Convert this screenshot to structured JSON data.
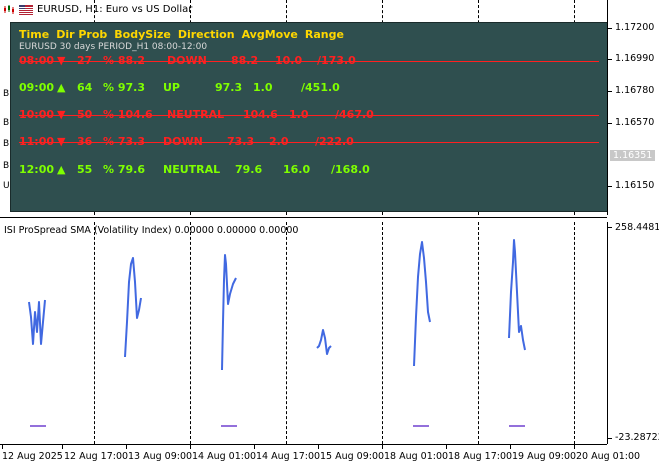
{
  "chart": {
    "symbol_title": "EURUSD, H1:  Euro vs US Dollar",
    "left_peek_labels": [
      "B",
      "B",
      "B",
      "B",
      "U"
    ],
    "price_ticks": [
      "1.17200",
      "1.16990",
      "1.16780",
      "1.16570",
      "1.16150"
    ],
    "current_price": "1.16351"
  },
  "panel": {
    "headers": [
      "Time",
      "Dir Prob",
      "BodySize",
      "Direction",
      "AvgMove",
      "Range"
    ],
    "subtitle": "EURUSD 30 days PERIOD_H1 08:00-12:00",
    "rows": [
      {
        "time": "08:00",
        "arrow": "▼",
        "prob": "27",
        "body": "% 88.2",
        "direction": "DOWN",
        "avg": "88.2",
        "x": "10.0",
        "range": "/173.0",
        "color": "red"
      },
      {
        "time": "09:00",
        "arrow": "▲",
        "prob": "64",
        "body": "% 97.3",
        "direction": "UP",
        "avg": "97.3",
        "x": "1.0",
        "range": "/451.0",
        "color": "green"
      },
      {
        "time": "10:00",
        "arrow": "▼",
        "prob": "50",
        "body": "% 104.6",
        "direction": "NEUTRAL",
        "avg": "104.6",
        "x": "1.0",
        "range": "/467.0",
        "color": "red"
      },
      {
        "time": "11:00",
        "arrow": "▼",
        "prob": "36",
        "body": "% 73.3",
        "direction": "DOWN",
        "avg": "73.3",
        "x": "2.0",
        "range": "/222.0",
        "color": "red"
      },
      {
        "time": "12:00",
        "arrow": "▲",
        "prob": "55",
        "body": "% 79.6",
        "direction": "NEUTRAL",
        "avg": "79.6",
        "x": "16.0",
        "range": "/168.0",
        "color": "green"
      }
    ]
  },
  "indicator": {
    "title": "ISI ProSpread SMA (Volatility Index) 0.00000 0.00000 0.00000",
    "scale_max": "258.44811",
    "scale_min": "-23.28722",
    "line_color": "#4169e1",
    "baseline_color": "#9370db"
  },
  "time_axis": {
    "labels": [
      "12 Aug 2025",
      "12 Aug 17:00",
      "13 Aug 09:00",
      "14 Aug 01:00",
      "14 Aug 17:00",
      "15 Aug 09:00",
      "18 Aug 01:00",
      "18 Aug 17:00",
      "19 Aug 09:00",
      "20 Aug 01:00"
    ]
  }
}
